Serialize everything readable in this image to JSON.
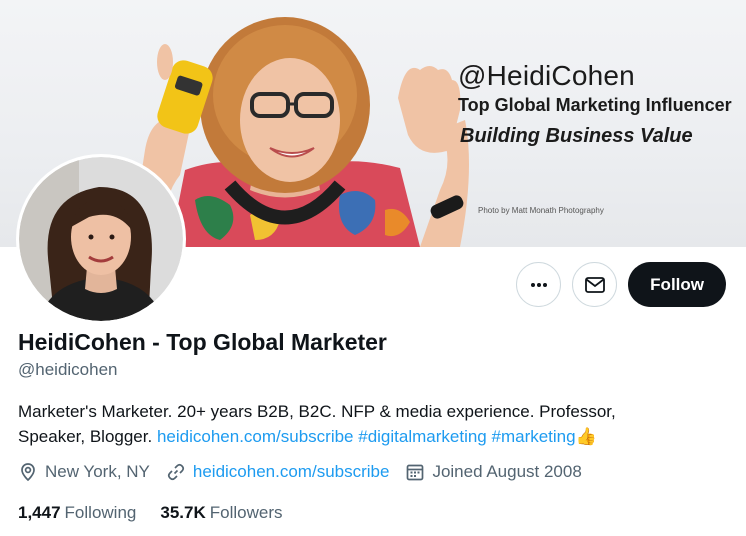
{
  "banner": {
    "handle": "@HeidiCohen",
    "tagline": "Top Global Marketing Influencer",
    "subline": "Building Business Value",
    "credit": "Photo by Matt Monath Photography"
  },
  "actions": {
    "more_icon": "more-horizontal-icon",
    "message_icon": "envelope-icon",
    "follow_label": "Follow"
  },
  "profile": {
    "name": "HeidiCohen - Top Global Marketer",
    "handle": "@heidicohen",
    "bio_line1": "Marketer's Marketer. 20+ years B2B, B2C. NFP & media experience. Professor,",
    "bio_line2_text": "Speaker, Blogger.",
    "bio_link": "heidicohen.com/subscribe",
    "bio_hashtag1": "#digitalmarketing",
    "bio_hashtag2": "#marketing",
    "bio_emoji": "👍",
    "location": "New York, NY",
    "website": "heidicohen.com/subscribe",
    "joined": "Joined August 2008",
    "following_count": "1,447",
    "following_label": "Following",
    "followers_count": "35.7K",
    "followers_label": "Followers"
  },
  "colors": {
    "link": "#1d9bf0",
    "text_primary": "#0f1419",
    "text_secondary": "#536471",
    "follow_bg": "#0f1419"
  }
}
